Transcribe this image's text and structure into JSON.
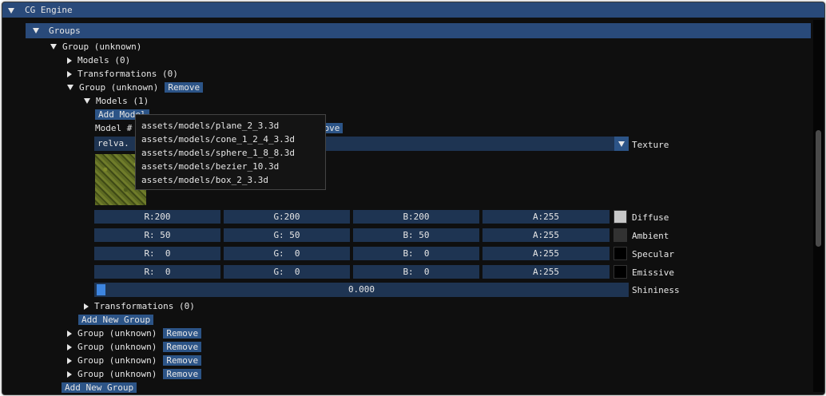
{
  "window": {
    "title": "CG Engine"
  },
  "groups_header": {
    "label": "Groups"
  },
  "tree": {
    "root_group": "Group (unknown)",
    "models_collapsed": "Models (0)",
    "transformations_collapsed": "Transformations (0)",
    "sub_group": "Group (unknown)",
    "sub_group_remove": "Remove",
    "models_open": "Models (1)",
    "add_model": "Add Model",
    "model_label_left": "Model #",
    "model_label_right": ")",
    "model_remove": "Remove",
    "transformations_inner": "Transformations (0)",
    "add_new_group_inner": "Add New Group",
    "siblings": [
      {
        "label": "Group (unknown)",
        "remove": "Remove"
      },
      {
        "label": "Group (unknown)",
        "remove": "Remove"
      },
      {
        "label": "Group (unknown)",
        "remove": "Remove"
      },
      {
        "label": "Group (unknown)",
        "remove": "Remove"
      }
    ],
    "add_new_group_outer": "Add New Group"
  },
  "texture": {
    "value": "relva.",
    "label": "Texture"
  },
  "colors": [
    {
      "label": "Diffuse",
      "r": "R:200",
      "g": "G:200",
      "b": "B:200",
      "a": "A:255",
      "swatch": "#c8c8c8"
    },
    {
      "label": "Ambient",
      "r": "R: 50",
      "g": "G: 50",
      "b": "B: 50",
      "a": "A:255",
      "swatch": "#323232"
    },
    {
      "label": "Specular",
      "r": "R:  0",
      "g": "G:  0",
      "b": "B:  0",
      "a": "A:255",
      "swatch": "#000000"
    },
    {
      "label": "Emissive",
      "r": "R:  0",
      "g": "G:  0",
      "b": "B:  0",
      "a": "A:255",
      "swatch": "#000000"
    }
  ],
  "shininess": {
    "value": "0.000",
    "label": "Shininess",
    "fraction": 0.0
  },
  "model_popup": {
    "items": [
      "assets/models/plane_2_3.3d",
      "assets/models/cone_1_2_4_3.3d",
      "assets/models/sphere_1_8_8.3d",
      "assets/models/bezier_10.3d",
      "assets/models/box_2_3.3d"
    ]
  },
  "theme": {
    "accent": "#294a7a",
    "button": "#2c5487",
    "frame": "#1e3452",
    "background": "#0f0f0f",
    "slider_grab": "#3d85e0"
  }
}
